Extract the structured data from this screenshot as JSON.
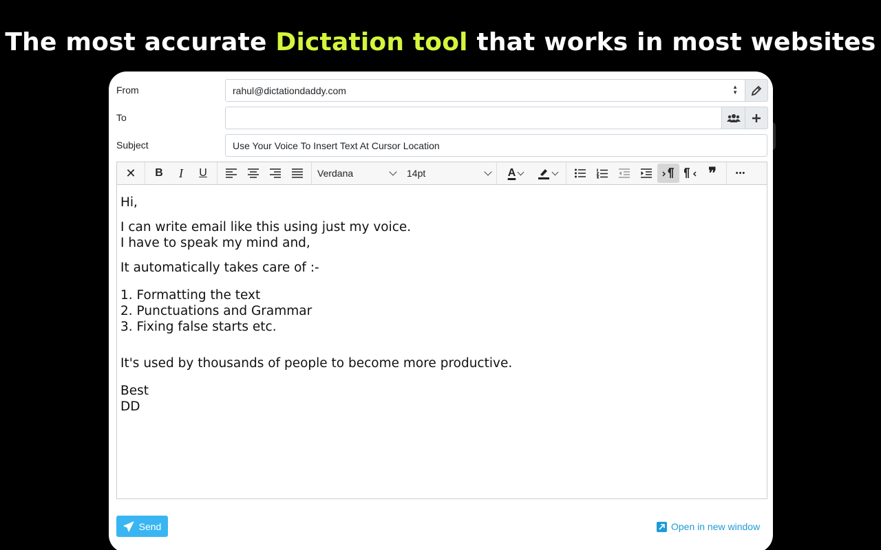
{
  "headline": {
    "before": "The most accurate ",
    "highlight": "Dictation tool",
    "after": " that works in most websites"
  },
  "colors": {
    "highlight": "#d4f53c",
    "send_button": "#39b6f2",
    "link": "#1e9bd7"
  },
  "form": {
    "from_label": "From",
    "from_value": "rahul@dictationdaddy.com",
    "to_label": "To",
    "to_value": "",
    "subject_label": "Subject",
    "subject_value": "Use Your Voice To Insert Text At Cursor Location"
  },
  "toolbar": {
    "font_family": "Verdana",
    "font_size": "14pt",
    "icons": [
      "clear-format-icon",
      "bold-icon",
      "italic-icon",
      "underline-icon",
      "align-left-icon",
      "align-center-icon",
      "align-right-icon",
      "justify-icon",
      "text-color-icon",
      "highlight-icon",
      "bullet-list-icon",
      "numbered-list-icon",
      "outdent-icon",
      "indent-icon",
      "ltr-icon",
      "rtl-icon",
      "blockquote-icon",
      "more-icon"
    ],
    "labels": {
      "bold": "B",
      "italic": "I",
      "underline": "U",
      "clear": "✕",
      "more": "•••",
      "text_color": "A",
      "quote": "❞"
    }
  },
  "body": {
    "greeting": "Hi,",
    "line1": "I can write email like this using just my voice.",
    "line2": "I have to speak my mind and,",
    "line3": "It automatically takes care of :-",
    "list": [
      "1. Formatting the text",
      "2. Punctuations and Grammar",
      "3. Fixing false starts etc."
    ],
    "line4": "It's used by thousands of people to become more productive.",
    "closing": "Best",
    "signature": "DD"
  },
  "actions": {
    "send_label": "Send",
    "open_window_label": "Open in new window"
  }
}
